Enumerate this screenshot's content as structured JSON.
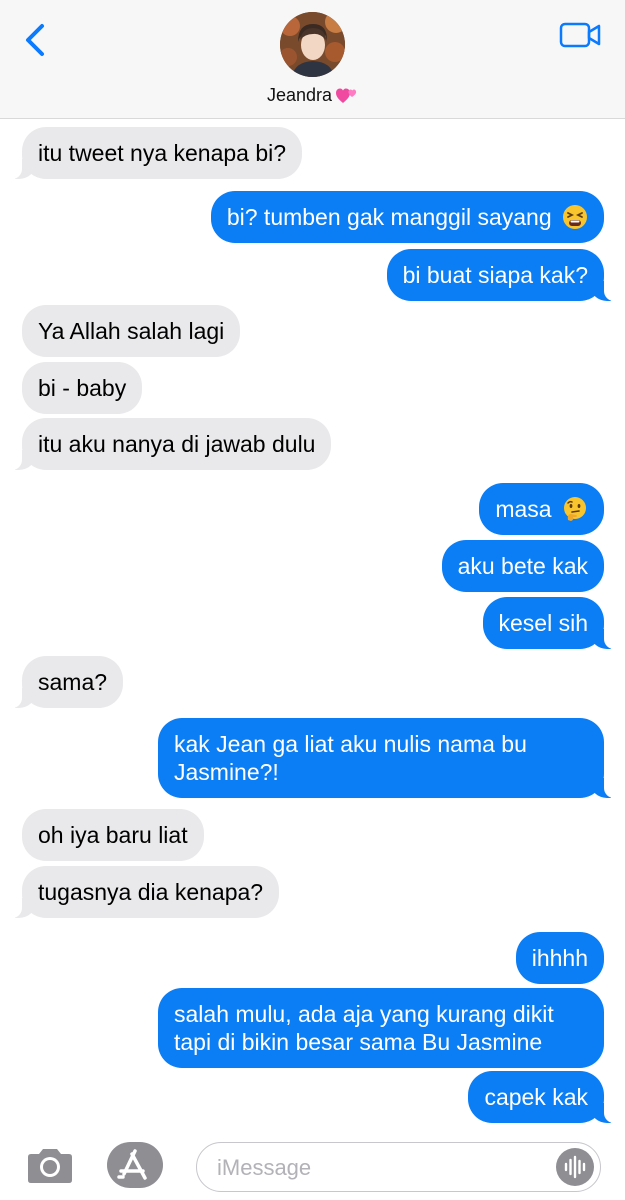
{
  "header": {
    "contact_name": "Jeandra",
    "name_emoji_icon": "two-hearts-icon",
    "back_icon": "chevron-left-icon",
    "video_icon": "video-camera-icon"
  },
  "messages": [
    {
      "from": "contact",
      "text": "itu tweet nya kenapa bi?"
    },
    {
      "from": "me",
      "text": "bi? tumben gak manggil sayang",
      "emoji": "tired-face-emoji"
    },
    {
      "from": "me",
      "text": "bi buat siapa kak?"
    },
    {
      "from": "contact",
      "text": "Ya Allah salah lagi"
    },
    {
      "from": "contact",
      "text": "bi - baby"
    },
    {
      "from": "contact",
      "text": "itu aku nanya di jawab dulu"
    },
    {
      "from": "me",
      "text": "masa",
      "emoji": "thinking-face-emoji"
    },
    {
      "from": "me",
      "text": "aku bete kak"
    },
    {
      "from": "me",
      "text": "kesel sih"
    },
    {
      "from": "contact",
      "text": "sama?"
    },
    {
      "from": "me",
      "text": "kak Jean ga liat aku nulis nama bu Jasmine?!"
    },
    {
      "from": "contact",
      "text": "oh iya baru liat"
    },
    {
      "from": "contact",
      "text": "tugasnya dia kenapa?"
    },
    {
      "from": "me",
      "text": "ihhhh"
    },
    {
      "from": "me",
      "text": "salah mulu, ada aja yang kurang dikit tapi di bikin besar sama Bu Jasmine"
    },
    {
      "from": "me",
      "text": "capek kak"
    }
  ],
  "composer": {
    "placeholder": "iMessage",
    "camera_icon": "camera-icon",
    "apps_icon": "app-store-icon",
    "audio_icon": "audio-waveform-icon"
  },
  "colors": {
    "sent_bubble": "#0b7ef6",
    "received_bubble": "#e9e9eb",
    "accent": "#0a7aff",
    "header_bg": "#f7f7f7"
  }
}
